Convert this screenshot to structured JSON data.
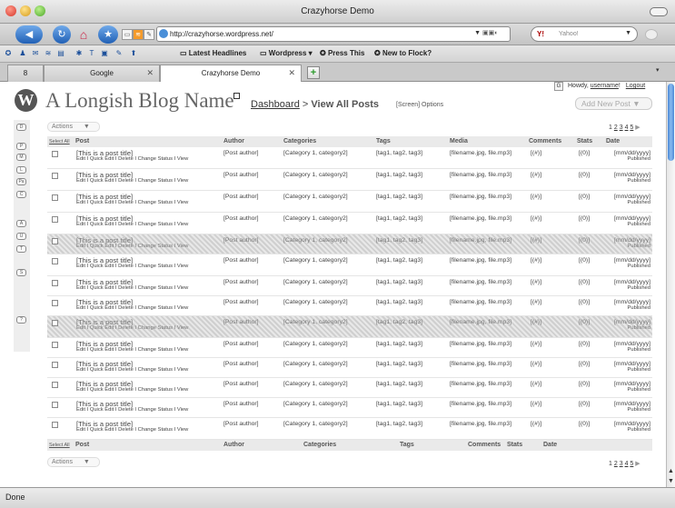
{
  "window": {
    "title": "Crazyhorse Demo"
  },
  "toolbar": {
    "url": "http://crazyhorse.wordpress.net/",
    "search_placeholder": "Yahoo!",
    "search_brand": "Y!"
  },
  "bookmarks": [
    {
      "label": "Latest Headlines"
    },
    {
      "label": "Wordpress ▾"
    },
    {
      "label": "Press This"
    },
    {
      "label": "New to Flock?"
    }
  ],
  "tabs": [
    {
      "label": "8",
      "active": false
    },
    {
      "label": "Google",
      "active": false
    },
    {
      "label": "Crazyhorse Demo",
      "active": true
    }
  ],
  "status": {
    "text": "Done"
  },
  "wp": {
    "blog_name": "A Longish Blog Name",
    "breadcrumb_link": "Dashboard",
    "breadcrumb_sep": ">",
    "breadcrumb_current": "View All Posts",
    "screen_options": "[Screen] Options",
    "g_button": "G",
    "howdy_prefix": "Howdy,",
    "username": "username",
    "logout": "Logout",
    "add_new": "Add New Post",
    "actions_label": "Actions",
    "pager": {
      "first": "1",
      "pages": [
        "2",
        "3",
        "4",
        "5"
      ],
      "next": "▶"
    },
    "sidebar_icons": [
      "D",
      "P",
      "M",
      "L",
      "Pa",
      "C",
      "A",
      "U",
      "T",
      "S",
      "?",
      ">"
    ],
    "headers": {
      "select_all": "Select All",
      "post": "Post",
      "author": "Author",
      "categories": "Categories",
      "tags": "Tags",
      "media": "Media",
      "comments": "Comments",
      "stats": "Stats",
      "date": "Date"
    },
    "row_template": {
      "title": "[This is a post title]",
      "actions": "Edit I  Quick Edit  I Delete   I Change Status I View",
      "author": "[Post author]",
      "categories": "[Category 1, category2]",
      "tags": "[tag1, tag2, tag3]",
      "media": "[filename.jpg, file.mp3]",
      "comments": "[(#)]",
      "stats": "[(0)]",
      "date": "[mm/dd/yyyy]",
      "status": "Published"
    },
    "rows": [
      {
        "highlighted": false
      },
      {
        "highlighted": false
      },
      {
        "highlighted": false
      },
      {
        "highlighted": false
      },
      {
        "highlighted": true
      },
      {
        "highlighted": false
      },
      {
        "highlighted": false
      },
      {
        "highlighted": false
      },
      {
        "highlighted": true
      },
      {
        "highlighted": false
      },
      {
        "highlighted": false
      },
      {
        "highlighted": false
      },
      {
        "highlighted": false
      },
      {
        "highlighted": false
      }
    ]
  }
}
